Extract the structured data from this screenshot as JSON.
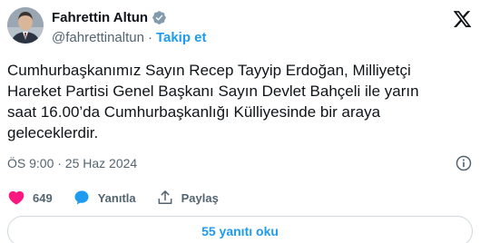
{
  "author": {
    "display_name": "Fahrettin Altun",
    "handle": "@fahrettinaltun",
    "separator": "·",
    "follow_label": "Takip et",
    "verified_color": "#829aab"
  },
  "tweet": {
    "lines": [
      "Cumhurbaşkanımız Sayın Recep Tayyip Erdoğan, Milliyetçi",
      "Hareket Partisi Genel Başkanı Sayın Devlet Bahçeli ile yarın",
      "saat 16.00’da Cumhurbaşkanlığı Külliyesinde bir araya",
      "geleceklerdir."
    ],
    "timestamp": "ÖS 9:00 · 25 Haz 2024"
  },
  "actions": {
    "like_count": "649",
    "reply_label": "Yanıtla",
    "share_label": "Paylaş"
  },
  "read_replies_label": "55 yanıtı oku",
  "colors": {
    "accent": "#1d9bf0",
    "like": "#f91880",
    "secondary_text": "#536471",
    "border": "#cfd9de"
  }
}
